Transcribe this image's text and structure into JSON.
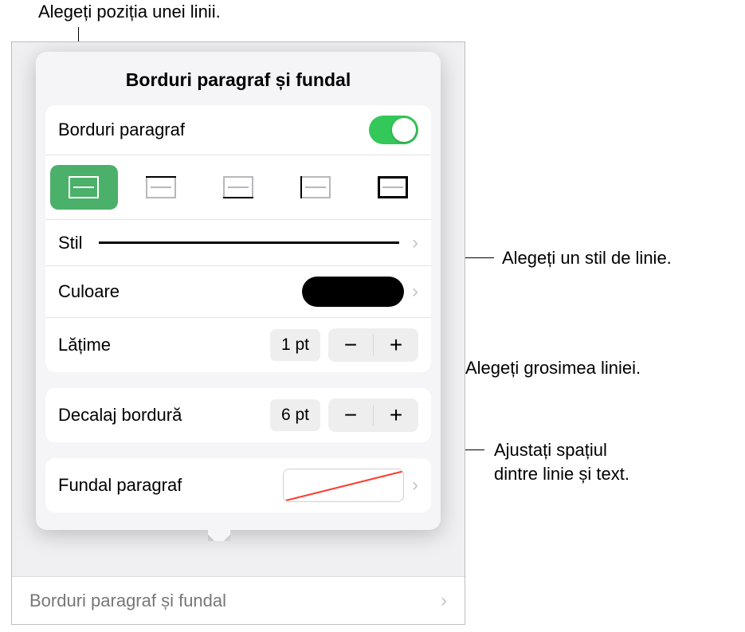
{
  "callouts": {
    "top": "Alegeți poziția unei linii.",
    "style": "Alegeți un stil de linie.",
    "width": "Alegeți grosimea liniei.",
    "offset_line1": "Ajustați spațiul",
    "offset_line2": "dintre linie și text."
  },
  "popover": {
    "title": "Borduri paragraf și fundal",
    "toggle_label": "Borduri paragraf",
    "toggle_on": true,
    "style_label": "Stil",
    "color_label": "Culoare",
    "color_value": "#000000",
    "width_label": "Lățime",
    "width_value": "1 pt",
    "offset_label": "Decalaj bordură",
    "offset_value": "6 pt",
    "bg_label": "Fundal paragraf"
  },
  "behind": {
    "label": "Borduri paragraf și fundal"
  },
  "positions": {
    "icons": [
      "border-all",
      "border-top",
      "border-bottom",
      "border-left",
      "border-right"
    ],
    "active_index": 0
  }
}
